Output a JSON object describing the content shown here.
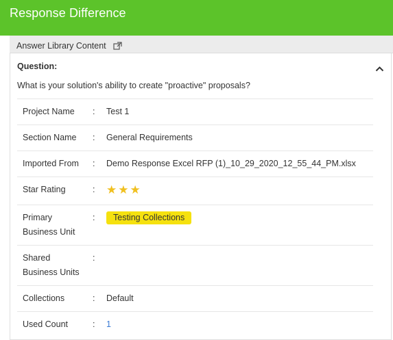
{
  "header": {
    "title": "Response Difference"
  },
  "library_bar": {
    "label": "Answer Library Content",
    "icon": "external-link-icon"
  },
  "question": {
    "label": "Question:",
    "text": "What is your solution's ability to create \"proactive\" proposals?"
  },
  "details": {
    "separator": ":",
    "project_name": {
      "label": "Project Name",
      "value": "Test 1"
    },
    "section_name": {
      "label": "Section Name",
      "value": "General Requirements"
    },
    "imported_from": {
      "label": "Imported From",
      "value": "Demo Response Excel RFP (1)_10_29_2020_12_55_44_PM.xlsx"
    },
    "star_rating": {
      "label": "Star Rating",
      "value": 3,
      "star_glyph": "★"
    },
    "primary_bu": {
      "label_line1": "Primary",
      "label_line2": "Business Unit",
      "value": "Testing Collections"
    },
    "shared_bu": {
      "label_line1": "Shared",
      "label_line2": "Business Units",
      "value": ""
    },
    "collections": {
      "label": "Collections",
      "value": "Default"
    },
    "used_count": {
      "label": "Used Count",
      "value": "1"
    }
  },
  "colors": {
    "header_bg": "#5cc32a",
    "badge_bg": "#f5e10f",
    "star": "#f0c020",
    "link": "#3a7bd5"
  }
}
